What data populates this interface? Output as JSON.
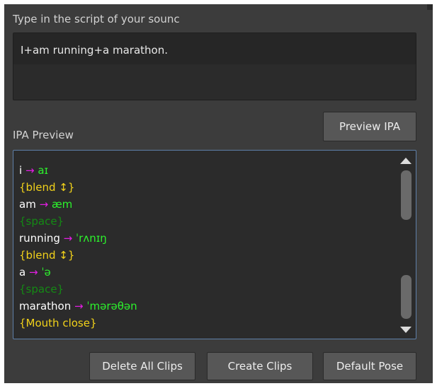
{
  "script_section": {
    "label": "Type in the script of your sounc",
    "value": "I+am running+a marathon."
  },
  "ipa_section": {
    "label": "IPA Preview",
    "preview_button": "Preview IPA",
    "lines": [
      {
        "word": "i",
        "arrow": "→",
        "ipa": "aɪ"
      },
      {
        "marker": "{blend ↕}"
      },
      {
        "word": "am",
        "arrow": "→",
        "ipa": "æm"
      },
      {
        "space": "{space}"
      },
      {
        "word": "running",
        "arrow": "→",
        "ipa": "ˈrʌnɪŋ"
      },
      {
        "marker": "{blend ↕}"
      },
      {
        "word": "a",
        "arrow": "→",
        "ipa": "ˈə"
      },
      {
        "space": "{space}"
      },
      {
        "word": "marathon",
        "arrow": "→",
        "ipa": "ˈmərəθən"
      },
      {
        "mouth": "{Mouth close}"
      }
    ]
  },
  "buttons": {
    "delete_all": "Delete All Clips",
    "create": "Create Clips",
    "default_pose": "Default Pose"
  },
  "colors": {
    "panel_bg": "#3c3c3c",
    "word": "#ffffff",
    "arrow": "#e21ee2",
    "ipa": "#2cf32c",
    "blend": "#f2d21a",
    "space": "#148a14",
    "focus_border": "#5e7fa8"
  }
}
